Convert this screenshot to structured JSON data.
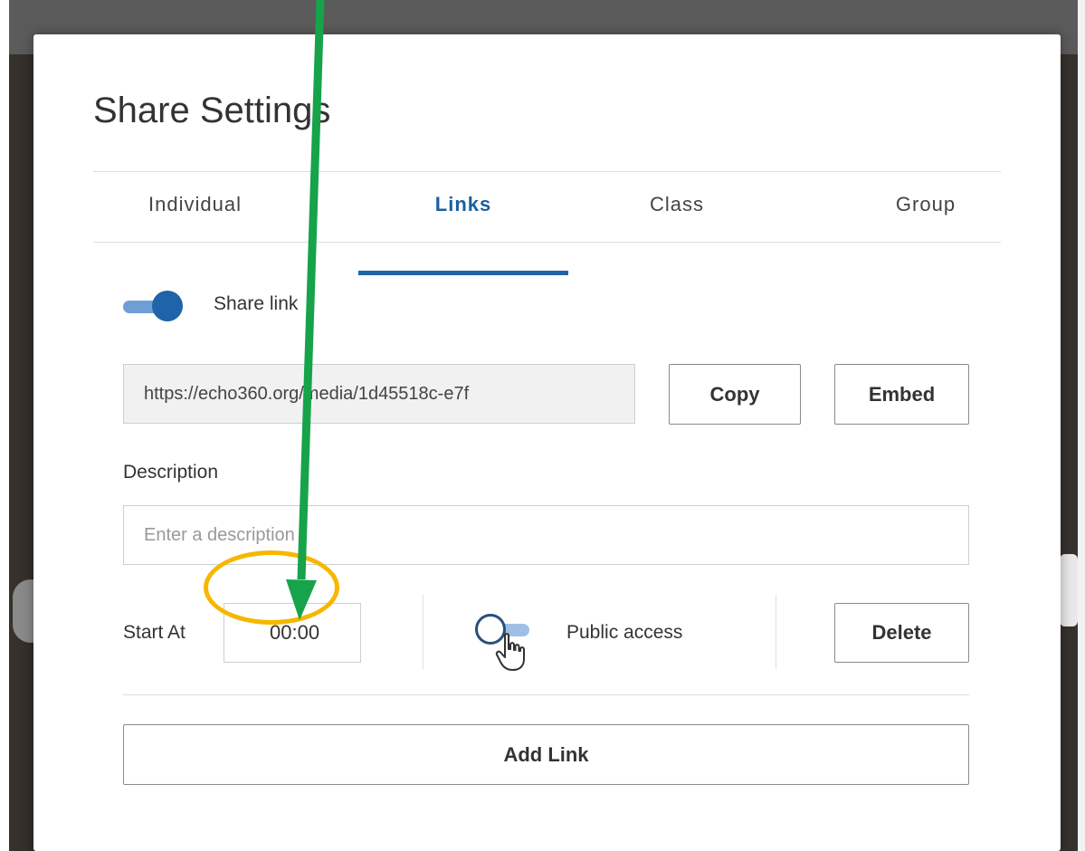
{
  "modal": {
    "title": "Share Settings"
  },
  "tabs": [
    {
      "label": "Individual",
      "active": false
    },
    {
      "label": "Links",
      "active": true
    },
    {
      "label": "Class",
      "active": false
    },
    {
      "label": "Group",
      "active": false
    }
  ],
  "share_link": {
    "label": "Share link",
    "enabled": true,
    "url": "https://echo360.org/media/1d45518c-e7f",
    "copy_label": "Copy",
    "embed_label": "Embed"
  },
  "description": {
    "label": "Description",
    "placeholder": "Enter a description",
    "value": ""
  },
  "start_at": {
    "label": "Start At",
    "value": "00:00"
  },
  "public_access": {
    "label": "Public access",
    "enabled": false
  },
  "delete_label": "Delete",
  "add_link_label": "Add Link",
  "colors": {
    "accent": "#1f63a8",
    "highlight_ellipse": "#f5b700",
    "annotation_arrow": "#16a34a"
  },
  "icons": {
    "cursor": "hand-pointer-icon"
  }
}
